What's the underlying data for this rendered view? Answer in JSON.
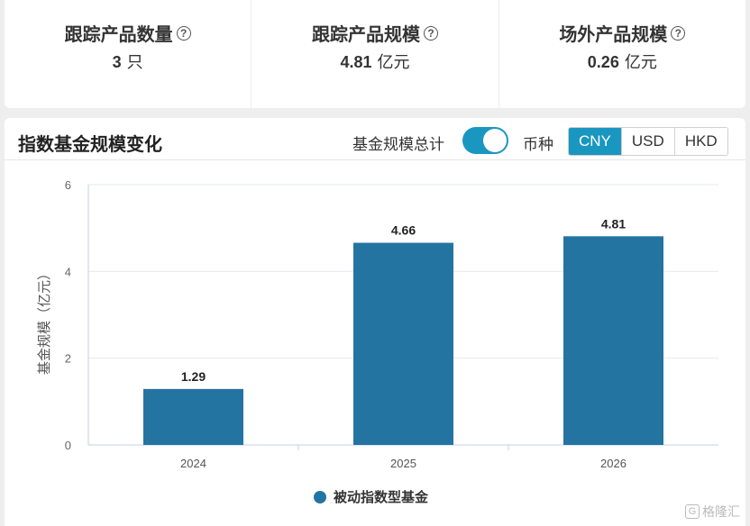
{
  "stats": [
    {
      "title": "跟踪产品数量",
      "value": "3",
      "unit": "只"
    },
    {
      "title": "跟踪产品规模",
      "value": "4.81",
      "unit": "亿元"
    },
    {
      "title": "场外产品规模",
      "value": "0.26",
      "unit": "亿元"
    }
  ],
  "help_icon": "?",
  "panel": {
    "title": "指数基金规模变化",
    "toggle_label": "基金规模总计",
    "toggle_on": true,
    "currency_label": "币种",
    "currencies": [
      "CNY",
      "USD",
      "HKD"
    ],
    "selected_currency": "CNY"
  },
  "colors": {
    "accent": "#1a97c0",
    "bar": "#2474a2"
  },
  "chart_data": {
    "type": "bar",
    "categories": [
      "2024",
      "2025",
      "2026"
    ],
    "series": [
      {
        "name": "被动指数型基金",
        "values": [
          1.29,
          4.66,
          4.81
        ]
      }
    ],
    "data_labels": [
      "1.29",
      "4.66",
      "4.81"
    ],
    "ylabel": "基金规模（亿元）",
    "ylim": [
      0,
      6
    ],
    "yticks": [
      0,
      2,
      4,
      6
    ],
    "grid": true,
    "legend": "bottom"
  },
  "watermark": {
    "icon": "G",
    "text": "格隆汇"
  }
}
